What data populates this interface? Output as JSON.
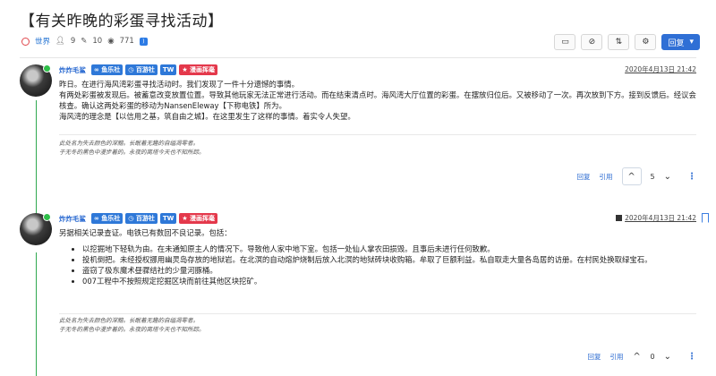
{
  "page": {
    "title": "【有关昨晚的彩蛋寻找活动】",
    "category": "世界",
    "posters": "9",
    "posts": "10",
    "views": "771"
  },
  "topbar": {
    "reply_label": "回复",
    "caret": "▾"
  },
  "posts": [
    {
      "username": "炸炸毛鲨",
      "badges": [
        "鱼乐社",
        "百游社",
        "TW",
        "漫画挥毫"
      ],
      "date": "2020年4月13日 21:42",
      "paragraphs": [
        "昨日。在进行海风湾彩蛋寻找活动时。我们发现了一件十分遗憾的事情。",
        "有两处彩蛋被发现后。被蓄意改变放置位置。导致其他玩家无法正常进行活动。而在结束清点时。海风湾大厅位置的彩蛋。在摆放归位后。又被移动了一次。再次放到下方。接到反馈后。经议会核查。确认这两处彩蛋的移动为NansenEleway【下称电铁】所为。",
        "海风湾的理念是【以信用之基，筑自由之城】。在这里发生了这样的事情。着实令人失望。"
      ],
      "signature": [
        "此处名为失去颜色的深黯。长眠着无趣的自缢凋零者。",
        "于无冬的黑色中漫步着的。永夜的离塔今天也不知所踪。"
      ],
      "reply_label": "回复",
      "quote_label": "引用",
      "votes": "5",
      "more": "⋮"
    },
    {
      "username": "炸炸毛鲨",
      "badges": [
        "鱼乐社",
        "百游社",
        "TW",
        "漫画挥毫"
      ],
      "date": "2020年4月13日 21:42",
      "intro": "另据相关记录查证。电铁已有数回不良记录。包括：",
      "list": [
        "以挖掘地下轻轨为由。在未通知原主人的情况下。导致他人家中地下室。包括一处仙人掌农田损毁。且事后未进行任何致歉。",
        "投机倒把。未经授权挪用幽灵岛存放的地狱岩。在北溟的自动熔炉烧制后放入北溟的地狱砖块收购箱。牟取了巨额利益。私自取走大量各岛居的访册。在村民处换取绿宝石。",
        "盗窃了极东魔术昼骤结社的少量河豚桶。",
        "007工程中不按照规定挖掘区块而前往其他区块挖矿。"
      ],
      "signature": [
        "此处名为失去颜色的深黯。长眠着无趣的自缢凋零者。",
        "于无冬的黑色中漫步着的。永夜的离塔今天也不知所踪。"
      ],
      "reply_label": "回复",
      "quote_label": "引用",
      "votes": "0",
      "more": "⋮"
    }
  ]
}
